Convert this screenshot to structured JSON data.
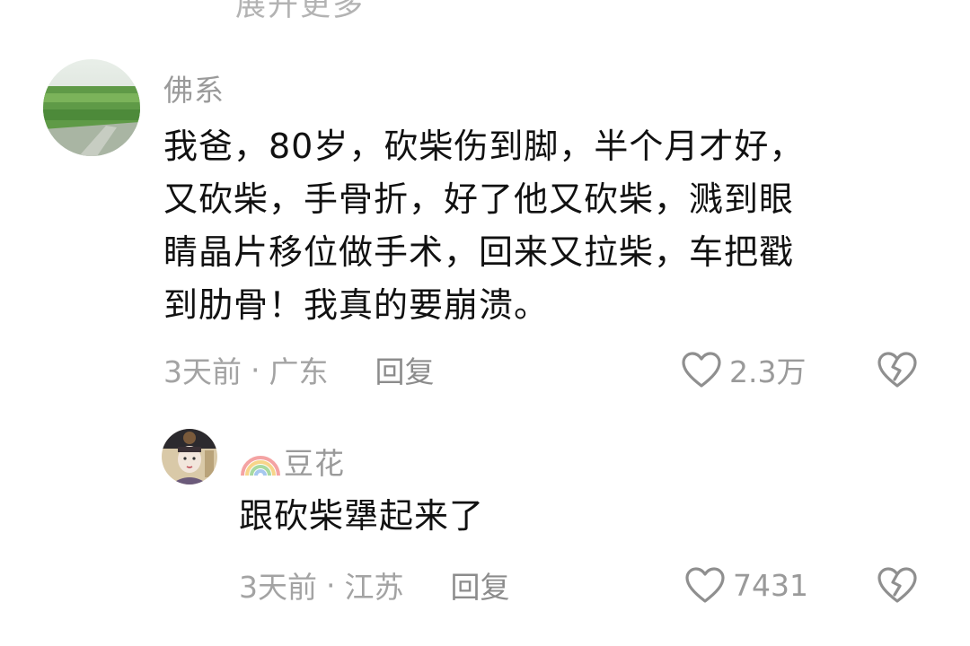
{
  "top_partial_text": "展开更多",
  "comments": [
    {
      "username": "佛系 ",
      "lines": [
        "我爸，80岁，砍柴伤到脚，半个月才好，",
        "又砍柴，手骨折，好了他又砍柴，溅到眼",
        "睛晶片移位做手术，回来又拉柴，车把戳",
        "到肋骨！我真的要崩溃。"
      ],
      "time": "3天前",
      "separator": "·",
      "location": "广东",
      "reply_label": "回复",
      "like_count": "2.3万",
      "like_icon": "heart-outline-icon",
      "dislike_icon": "broken-heart-icon"
    },
    {
      "username": "豆花",
      "lines": [
        "跟砍柴犟起来了"
      ],
      "time": "3天前",
      "separator": "·",
      "location": "江苏",
      "reply_label": "回复",
      "like_count": "7431",
      "like_icon": "heart-outline-icon",
      "dislike_icon": "broken-heart-icon"
    }
  ],
  "colors": {
    "text_primary": "#111111",
    "text_secondary": "#a3a3a3",
    "icon_gray": "#8f8f8f"
  }
}
